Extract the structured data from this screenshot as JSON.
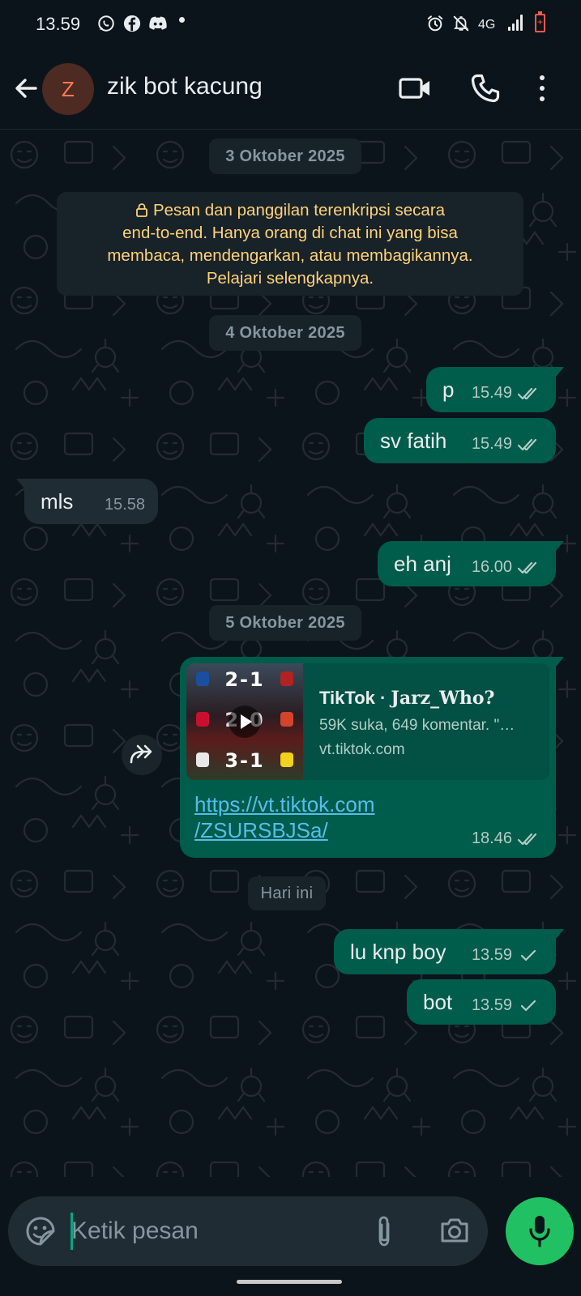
{
  "status_bar": {
    "time": "13.59",
    "network": "4G",
    "icons": [
      "whatsapp-icon",
      "facebook-icon",
      "discord-icon",
      "dot-icon",
      "alarm-icon",
      "mute-bell-icon",
      "signal-icon",
      "battery-low-icon"
    ]
  },
  "header": {
    "avatar_initial": "Z",
    "contact_name": "zik bot kacung",
    "actions": [
      "back-arrow-icon",
      "video-call-icon",
      "voice-call-icon",
      "more-vert-icon"
    ]
  },
  "chat": {
    "dates": [
      "3 Oktober 2025",
      "4 Oktober 2025",
      "5 Oktober 2025",
      "Hari ini"
    ],
    "encryption_notice": {
      "line1": "Pesan dan panggilan terenkripsi secara",
      "line2": "end-to-end. Hanya orang di chat ini yang bisa",
      "line3": "membaca, mendengarkan, atau membagikannya.",
      "line4": "Pelajari selengkapnya."
    },
    "messages": [
      {
        "dir": "out",
        "text": "p",
        "time": "15.49",
        "status": "read"
      },
      {
        "dir": "out",
        "text": "sv fatih",
        "time": "15.49",
        "status": "read"
      },
      {
        "dir": "in",
        "text": "mls",
        "time": "15.58"
      },
      {
        "dir": "out",
        "text": "eh anj",
        "time": "16.00",
        "status": "read"
      },
      {
        "dir": "out",
        "type": "link",
        "time": "18.46",
        "status": "read",
        "preview": {
          "site": "TikTok · ",
          "author": "Jarz_Who?",
          "description": "59K suka, 649 komentar. \"…",
          "domain": "vt.tiktok.com",
          "scores": [
            "2-1",
            "2-0",
            "3-1"
          ]
        },
        "url_line1": "https://vt.tiktok.com",
        "url_line2": "/ZSURSBJSa/"
      },
      {
        "dir": "out",
        "text": "lu knp boy",
        "time": "13.59",
        "status": "sent"
      },
      {
        "dir": "out",
        "text": "bot",
        "time": "13.59",
        "status": "sent"
      }
    ]
  },
  "composer": {
    "placeholder": "Ketik pesan"
  },
  "colors": {
    "background": "#0b141a",
    "outgoing_bubble": "#005c4b",
    "incoming_bubble": "#202c33",
    "accent": "#21c063",
    "read_ticks": "#b3ccc6",
    "link": "#53bdeb",
    "notice_text": "#ffd279"
  }
}
